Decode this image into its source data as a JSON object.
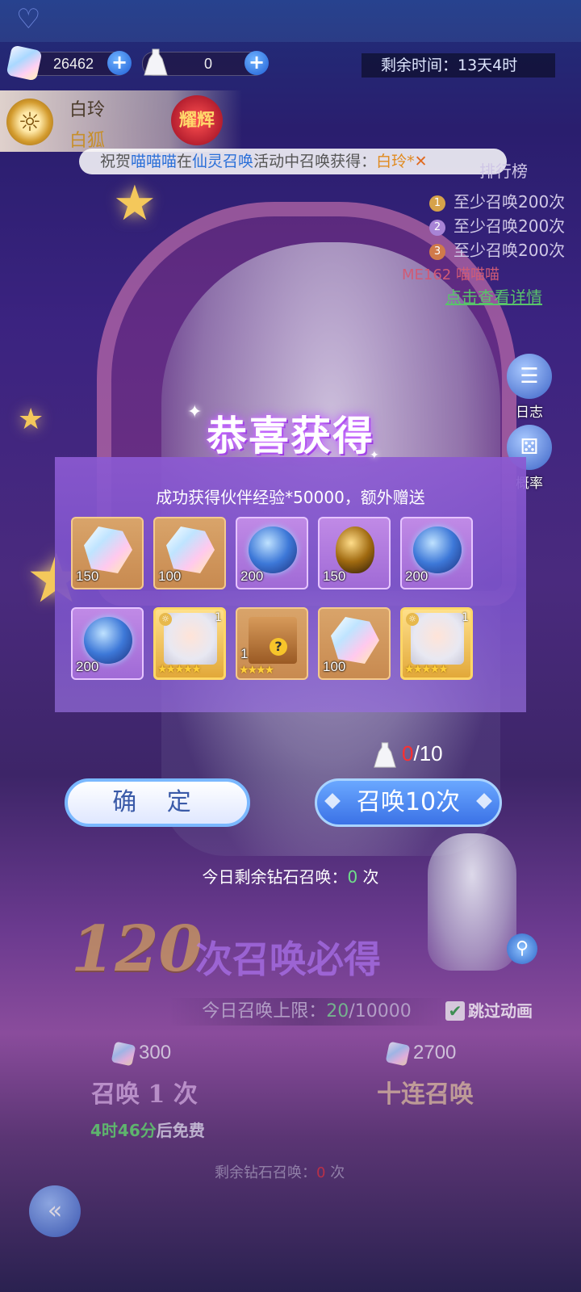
{
  "topbar": {
    "gems": "26462",
    "dresses": "0",
    "timer": "剩余时间：13天4时"
  },
  "character": {
    "name": "白玲",
    "subtitle": "白狐",
    "badge": "耀辉"
  },
  "announcement": {
    "prefix": "祝贺",
    "user": "喵喵喵",
    "mid1": "在",
    "event": "仙灵召唤",
    "mid2": "活动中召唤获得：",
    "reward": "白玲*"
  },
  "ranking": {
    "title": "排行榜",
    "rows": [
      {
        "rank": "1",
        "text": "至少召唤200次"
      },
      {
        "rank": "2",
        "text": "至少召唤200次"
      },
      {
        "rank": "3",
        "text": "至少召唤200次"
      }
    ],
    "me": "ME162 喵喵喵",
    "link": "点击查看详情"
  },
  "side": {
    "log": "日志",
    "rate": "概率"
  },
  "popup": {
    "title": "恭喜获得",
    "subtitle": "成功获得伙伴经验*50000，额外赠送",
    "items": [
      {
        "kind": "crystal",
        "frame": "gold",
        "count": "150"
      },
      {
        "kind": "crystal",
        "frame": "gold",
        "count": "100"
      },
      {
        "kind": "orb",
        "frame": "purple",
        "count": "200"
      },
      {
        "kind": "egg",
        "frame": "purple",
        "count": "150"
      },
      {
        "kind": "orb",
        "frame": "purple",
        "count": "200"
      },
      {
        "kind": "orb",
        "frame": "purple",
        "count": "200"
      },
      {
        "kind": "character-card",
        "frame": "card",
        "count": "1",
        "stars": "★★★★★"
      },
      {
        "kind": "mystery-box",
        "frame": "gold",
        "count": "1",
        "stars": "★★★★"
      },
      {
        "kind": "crystal",
        "frame": "gold",
        "count": "100"
      },
      {
        "kind": "character-card",
        "frame": "card",
        "count": "1",
        "stars": "★★★★★"
      }
    ],
    "counter_current": "0",
    "counter_total": "/10",
    "confirm": "确 定",
    "summon10": "召唤10次",
    "today_label": "今日剩余钻石召唤：",
    "today_value": "0",
    "today_unit": "次"
  },
  "summon": {
    "guarantee_num": "120",
    "guarantee_text": "次召唤必得",
    "limit_label": "今日召唤上限：",
    "limit_current": "20",
    "limit_total": "/10000",
    "skip": "跳过动画",
    "price1": "300",
    "price10": "2700",
    "btn1": "召唤 1 次",
    "btn10": "十连召唤",
    "free_time": "4时46分",
    "free_suffix": "后免费",
    "remain_label": "剩余钻石召唤：",
    "remain_value": "0",
    "remain_unit": "次"
  },
  "colors": {
    "accent_blue": "#3b72e6",
    "popup_purple": "#8c5ad2",
    "gold": "#f1c04a",
    "highlight_green": "#6fe08a",
    "alert_red": "#ff3030"
  }
}
